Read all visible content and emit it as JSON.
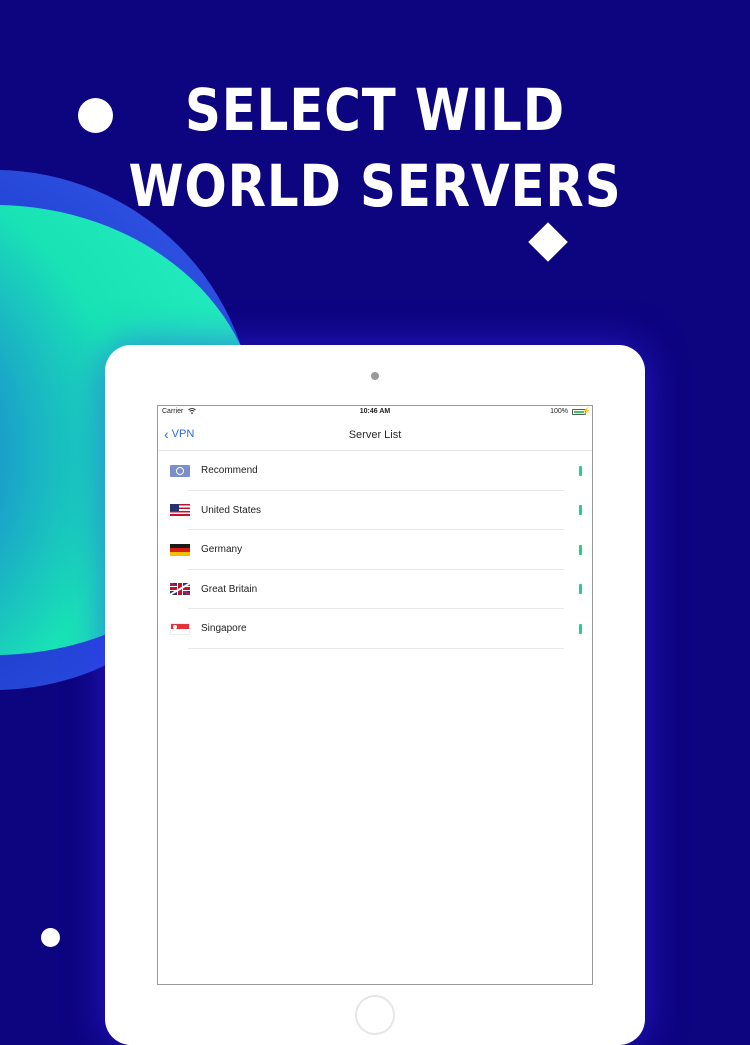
{
  "headline": {
    "line1": "SELECT WILD",
    "line2": "WORLD SERVERS"
  },
  "status_bar": {
    "carrier": "Carrier",
    "time": "10:46 AM",
    "battery": "100%"
  },
  "nav": {
    "back_label": "VPN",
    "title": "Server List"
  },
  "servers": [
    {
      "name": "Recommend",
      "flag": "world-flag-icon"
    },
    {
      "name": "United States",
      "flag": "us-flag-icon"
    },
    {
      "name": "Germany",
      "flag": "germany-flag-icon"
    },
    {
      "name": "Great Britain",
      "flag": "gb-flag-icon"
    },
    {
      "name": "Singapore",
      "flag": "singapore-flag-icon"
    }
  ],
  "colors": {
    "background": "#0d0480",
    "accent_teal": "#19e3b5",
    "signal_green": "#1fd18a",
    "link_blue": "#2f6bd8"
  }
}
